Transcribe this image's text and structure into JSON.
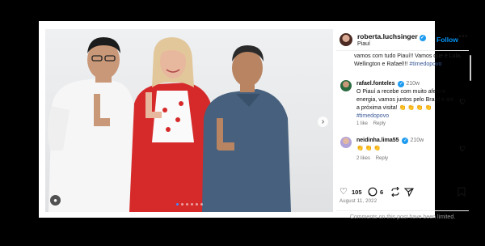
{
  "post": {
    "username": "roberta.luchsinger",
    "location": "Piauí",
    "follow_label": "Follow",
    "more_label": "•••",
    "caption_text": "vamos com tudo Piauí!! Vamos que é Lula, Wellington e Rafael!!! ",
    "caption_hashtag": "#timedopovo",
    "likes": "105",
    "comments_count": "6",
    "date": "August 11, 2022",
    "comments_limited": "Comments on this post have been limited."
  },
  "comments": [
    {
      "username": "rafael.fonteles",
      "time": "210w",
      "text": "O Piauí a recebe com muito afeto e energia, vamos juntos pelo Brasil e até a próxima visita! 👏 👏 👏 👏",
      "hashtag": "#timedopovo",
      "likes": "1 like",
      "reply_label": "Reply"
    },
    {
      "username": "neidinha.lima55",
      "time": "210w",
      "text": "👏 👏 👏",
      "likes": "2 likes",
      "reply_label": "Reply"
    }
  ],
  "carousel": {
    "slide_count": 6,
    "active_index": 0
  },
  "icons": {
    "verified": "verified-badge-icon",
    "heart": "heart-icon",
    "comment": "comment-icon",
    "repost": "repost-icon",
    "share": "share-icon",
    "save": "bookmark-icon"
  },
  "colors": {
    "accent": "#0095f6",
    "verified": "#1d9bf0",
    "jacket": "#d62a2a"
  }
}
